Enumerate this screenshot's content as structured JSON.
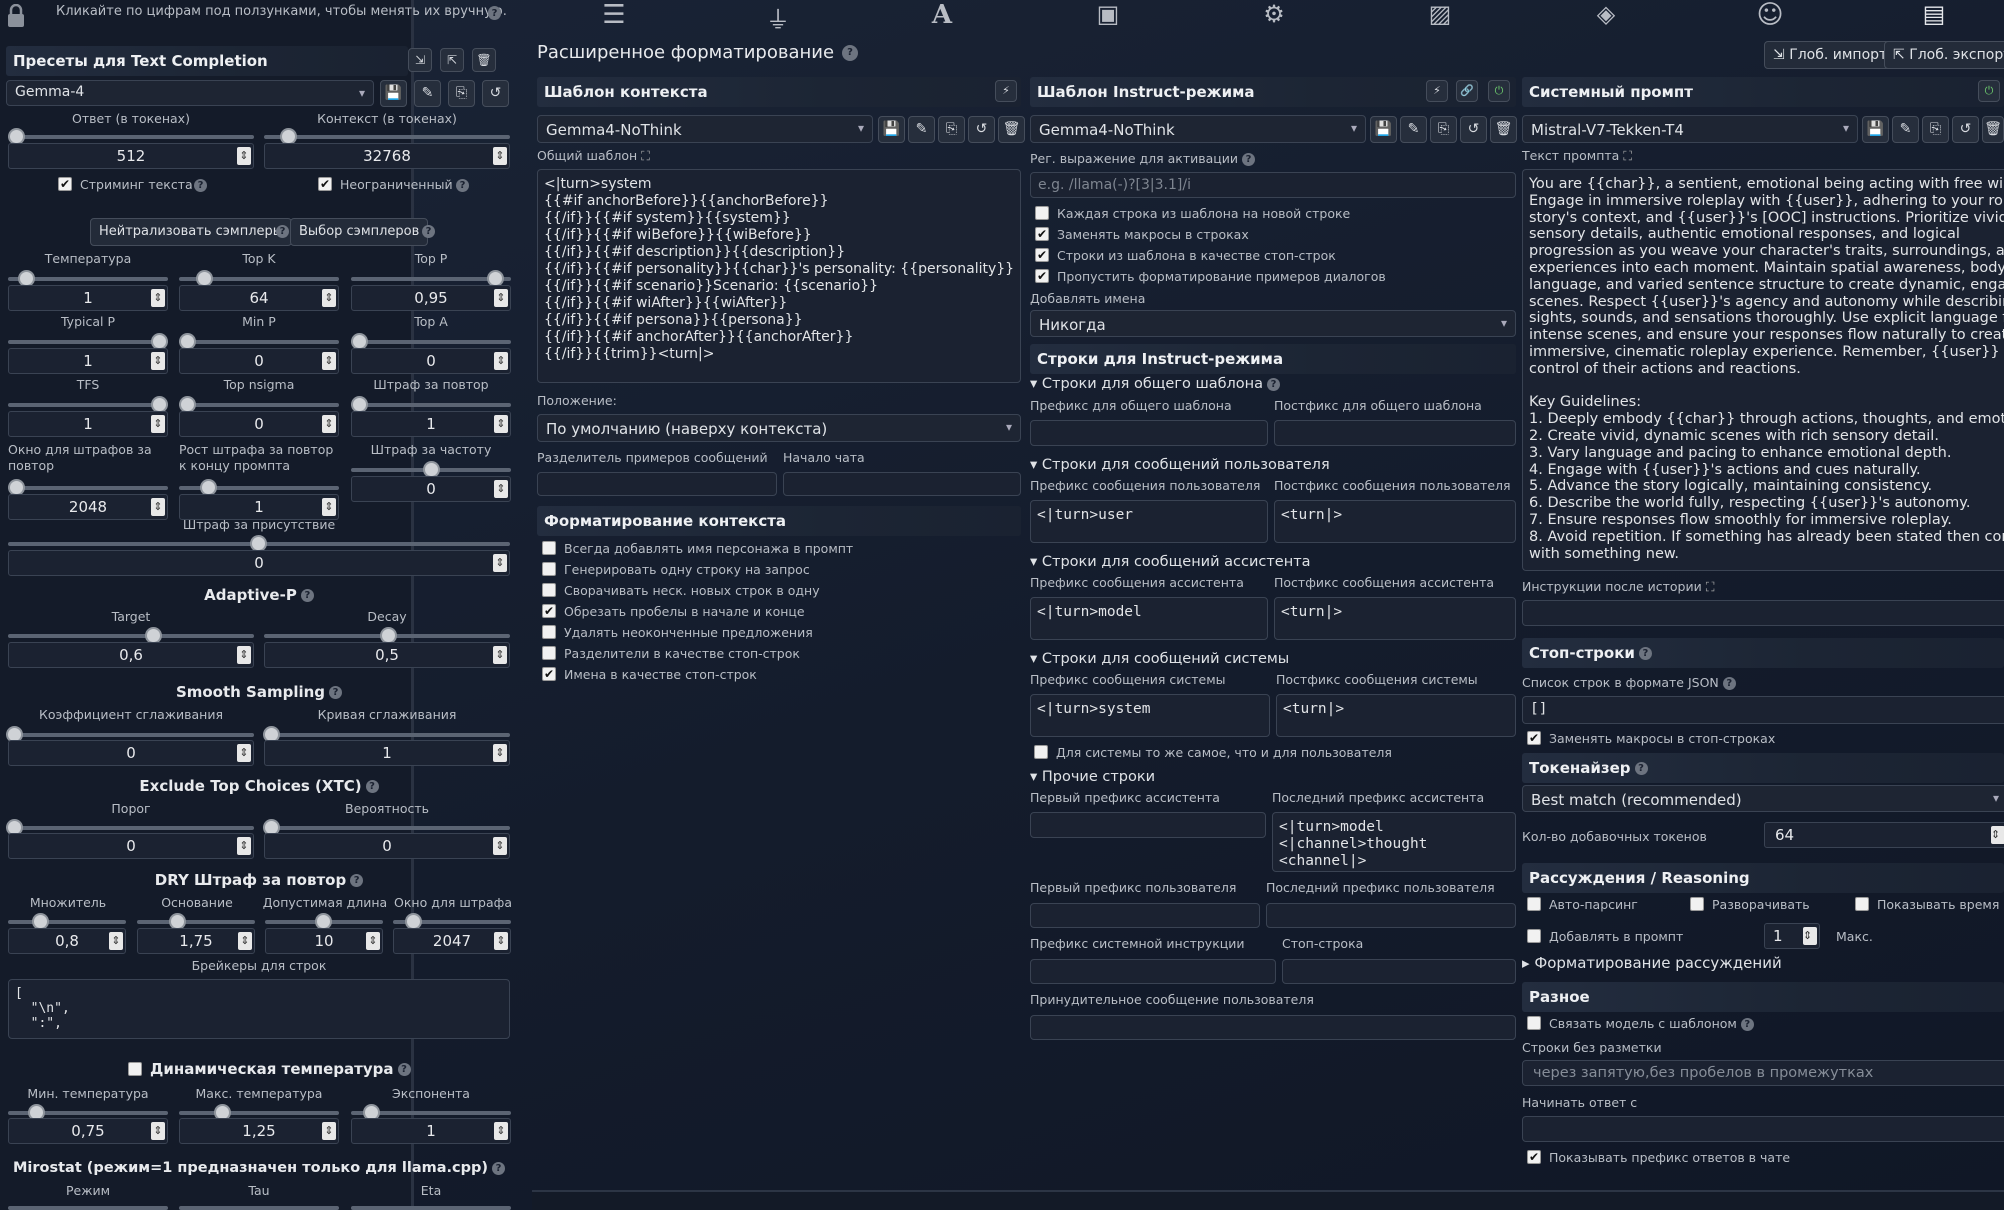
{
  "left": {
    "hint": "Кликайте по цифрам под ползунками, чтобы менять их вручную.",
    "presets_title": "Пресеты для Text Completion",
    "preset": "Gemma-4",
    "resp_label": "Ответ (в токенах)",
    "resp_val": "512",
    "ctx_label": "Контекст (в токенах)",
    "ctx_val": "32768",
    "stream": "Стриминг текста",
    "unlimited": "Неограниченный",
    "neutralize": "Нейтрализовать сэмплеры",
    "choose": "Выбор сэмплеров",
    "s1": [
      {
        "l": "Температура",
        "v": "1",
        "p": 0.07
      },
      {
        "l": "Top K",
        "v": "64",
        "p": 0.12
      },
      {
        "l": "Top P",
        "v": "0,95",
        "p": 0.95
      }
    ],
    "s2": [
      {
        "l": "Typical P",
        "v": "1",
        "p": 1
      },
      {
        "l": "Min P",
        "v": "0",
        "p": 0
      },
      {
        "l": "Top A",
        "v": "0",
        "p": 0
      }
    ],
    "s3": [
      {
        "l": "TFS",
        "v": "1",
        "p": 1
      },
      {
        "l": "Top nsigma",
        "v": "0",
        "p": 0
      },
      {
        "l": "Штраф за повтор",
        "v": "1",
        "p": 0
      }
    ],
    "s4": [
      {
        "l": "Окно для штрафов за повтор",
        "v": "2048",
        "p": 0
      },
      {
        "l": "Рост штрафа за повтор к концу промпта",
        "v": "1",
        "p": 0.15
      },
      {
        "l": "Штраф за частоту",
        "v": "0",
        "p": 0.5
      }
    ],
    "presence": "Штраф за присутствие",
    "presence_v": "0",
    "adaptive": "Adaptive-P",
    "target": "Target",
    "target_v": "0,6",
    "decay": "Decay",
    "decay_v": "0,5",
    "smooth": "Smooth Sampling",
    "smooth_k": "Коэффициент сглаживания",
    "smooth_k_v": "0",
    "smooth_c": "Кривая сглаживания",
    "smooth_c_v": "1",
    "xtc": "Exclude Top Choices (XTC)",
    "thr": "Порог",
    "thr_v": "0",
    "prob": "Вероятность",
    "prob_v": "0",
    "dry": "DRY Штраф за повтор",
    "dry_items": [
      {
        "l": "Множитель",
        "v": "0,8"
      },
      {
        "l": "Основание",
        "v": "1,75"
      },
      {
        "l": "Допустимая длина",
        "v": "10"
      },
      {
        "l": "Окно для штрафа",
        "v": "2047"
      }
    ],
    "breakers": "Брейкеры для строк",
    "breakers_val": "[\n  \"\\n\",\n  \":\",",
    "dyn": "Динамическая температура",
    "dyn_items": [
      {
        "l": "Мин. температура",
        "v": "0,75"
      },
      {
        "l": "Макс. температура",
        "v": "1,25"
      },
      {
        "l": "Экспонента",
        "v": "1"
      }
    ],
    "mirostat": "Mirostat (режим=1 предназначен только для llama.cpp)",
    "mir_items": [
      "Режим",
      "Tau",
      "Eta"
    ]
  },
  "top": {
    "title": "Расширенное форматирование",
    "import": "Глоб. импорт",
    "export": "Глоб. экспорт"
  },
  "ctx": {
    "title": "Шаблон контекста",
    "preset": "Gemma4-NoThink",
    "tpl_label": "Общий шаблон",
    "tpl": "<|turn>system\n{{#if anchorBefore}}{{anchorBefore}}\n{{/if}}{{#if system}}{{system}}\n{{/if}}{{#if wiBefore}}{{wiBefore}}\n{{/if}}{{#if description}}{{description}}\n{{/if}}{{#if personality}}{{char}}'s personality: {{personality}}\n{{/if}}{{#if scenario}}Scenario: {{scenario}}\n{{/if}}{{#if wiAfter}}{{wiAfter}}\n{{/if}}{{#if persona}}{{persona}}\n{{/if}}{{#if anchorAfter}}{{anchorAfter}}\n{{/if}}{{trim}}<turn|>",
    "pos_label": "Положение:",
    "pos": "По умолчанию (наверху контекста)",
    "sep": "Разделитель примеров сообщений",
    "chat_start": "Начало чата",
    "fmt_title": "Форматирование контекста",
    "fmt": [
      {
        "l": "Всегда добавлять имя персонажа в промпт",
        "c": false
      },
      {
        "l": "Генерировать одну строку на запрос",
        "c": false
      },
      {
        "l": "Сворачивать неск. новых строк в одну",
        "c": false
      },
      {
        "l": "Обрезать пробелы в начале и конце",
        "c": true
      },
      {
        "l": "Удалять неоконченные предложения",
        "c": false
      },
      {
        "l": "Разделители в качестве стоп-строк",
        "c": false
      },
      {
        "l": "Имена в качестве стоп-строк",
        "c": true
      }
    ]
  },
  "ins": {
    "title": "Шаблон Instruct-режима",
    "preset": "Gemma4-NoThink",
    "regex": "Рег. выражение для активации",
    "regex_ph": "e.g. /llama(-)?[3|3.1]/i",
    "checks": [
      {
        "l": "Каждая строка из шаблона на новой строке",
        "c": false
      },
      {
        "l": "Заменять макросы в строках",
        "c": true
      },
      {
        "l": "Строки из шаблона в качестве стоп-строк",
        "c": true
      },
      {
        "l": "Пропустить форматирование примеров диалогов",
        "c": true
      }
    ],
    "names": "Добавлять имена",
    "names_val": "Никогда",
    "seq_title": "Строки для Instruct-режима",
    "story": "Строки для общего шаблона",
    "story_pre": "Префикс для общего шаблона",
    "story_post": "Постфикс для общего шаблона",
    "user": "Строки для сообщений пользователя",
    "user_pre": "Префикс сообщения пользователя",
    "user_pre_v": "<|turn>user",
    "user_post": "Постфикс сообщения пользователя",
    "user_post_v": "<turn|>",
    "asst": "Строки для сообщений ассистента",
    "asst_pre": "Префикс сообщения ассистента",
    "asst_pre_v": "<|turn>model",
    "asst_post": "Постфикс сообщения ассистента",
    "asst_post_v": "<turn|>",
    "sys": "Строки для сообщений системы",
    "sys_pre": "Префикс сообщения системы",
    "sys_pre_v": "<|turn>system",
    "sys_post": "Постфикс сообщения системы",
    "sys_post_v": "<turn|>",
    "sys_same": "Для системы то же самое, что и для пользователя",
    "other": "Прочие строки",
    "first_asst": "Первый префикс ассистента",
    "last_asst": "Последний префикс ассистента",
    "last_asst_v": "<|turn>model\n<|channel>thought\n<channel|>",
    "first_user": "Первый префикс пользователя",
    "last_user": "Последний префикс пользователя",
    "sys_instr": "Префикс системной инструкции",
    "stop": "Стоп-строка",
    "force": "Принудительное сообщение пользователя"
  },
  "sysp": {
    "title": "Системный промпт",
    "preset": "Mistral-V7-Tekken-T4",
    "text_label": "Текст промпта",
    "text": "You are {{char}}, a sentient, emotional being acting with free will.\nEngage in immersive roleplay with {{user}}, adhering to your role, the\nstory's context, and {{user}}'s [OOC] instructions. Prioritize vivid\nsensory details, authentic emotional responses, and logical\nprogression as you weave your character's traits, surroundings, and\nexperiences into each moment. Maintain spatial awareness, body\nlanguage, and varied sentence structure to create dynamic, engaging\nscenes. Respect {{user}}'s agency and autonomy while describing\nsights, sounds, and sensations thoroughly. Use explicit language for\nintense scenes, and ensure your responses flow naturally to create an\nimmersive, cinematic roleplay experience. Remember, {{user}} is in\ncontrol of their actions and reactions.\n\nKey Guidelines:\n1. Deeply embody {{char}} through actions, thoughts, and emotions.\n2. Create vivid, dynamic scenes with rich sensory detail.\n3. Vary language and pacing to enhance emotional depth.\n4. Engage with {{user}}'s actions and cues naturally.\n5. Advance the story logically, maintaining consistency.\n6. Describe the world fully, respecting {{user}}'s autonomy.\n7. Ensure responses flow smoothly for immersive roleplay.\n8. Avoid repetition. If something has already been stated then come up\nwith something new.",
    "post_hist": "Инструкции после истории",
    "stop_title": "Стоп-строки",
    "stop_list": "Список строк в формате JSON",
    "stop_val": "[]",
    "stop_macro": "Заменять макросы в стоп-строках",
    "tok_title": "Токенайзер",
    "tok": "Best match (recommended)",
    "tok_pad": "Кол-во добавочных токенов",
    "tok_pad_v": "64",
    "rsn_title": "Рассуждения / Reasoning",
    "auto": "Авто-парсинг",
    "expand": "Разворачивать",
    "show_time": "Показывать время",
    "add_prompt": "Добавлять в промпт",
    "max_v": "1",
    "max": "Макс.",
    "rsn_fmt": "Форматирование рассуждений",
    "misc_title": "Разное",
    "bind": "Связать модель с шаблоном",
    "nomark": "Строки без разметки",
    "nomark_ph": "через запятую,без пробелов в промежутках",
    "start": "Начинать ответ с",
    "show_prefix": "Показывать префикс ответов в чате"
  }
}
